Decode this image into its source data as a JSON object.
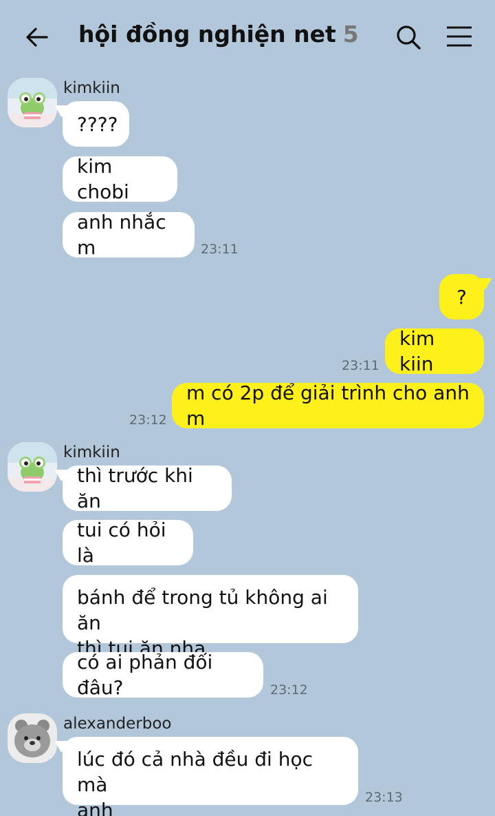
{
  "header": {
    "title": "hội đồng nghiện net",
    "member_count": "5"
  },
  "groups": [
    {
      "sender": "kimkiin",
      "messages": [
        "????",
        "kim chobi",
        "anh nhắc m"
      ],
      "time": "23:11"
    },
    {
      "outgoing": true,
      "messages": [
        "?",
        "kim kiin",
        "m có 2p để giải trình cho anh m"
      ],
      "times": [
        "23:11",
        "23:12"
      ]
    },
    {
      "sender": "kimkiin",
      "messages": [
        "thì trước khi ăn",
        "tui có hỏi là",
        "bánh để trong tủ không ai ăn\nthì tui ăn nha",
        "có ai phản đối đâu?"
      ],
      "time": "23:12"
    },
    {
      "sender": "alexanderboo",
      "messages": [
        "lúc đó cả nhà đều đi học mà\nanh"
      ],
      "time": "23:13"
    }
  ],
  "colors": {
    "background": "#b2c7da",
    "incoming_bubble": "#ffffff",
    "outgoing_bubble": "#fef01b"
  },
  "icons": {
    "back": "arrow-left-icon",
    "search": "search-icon",
    "menu": "hamburger-menu-icon"
  }
}
